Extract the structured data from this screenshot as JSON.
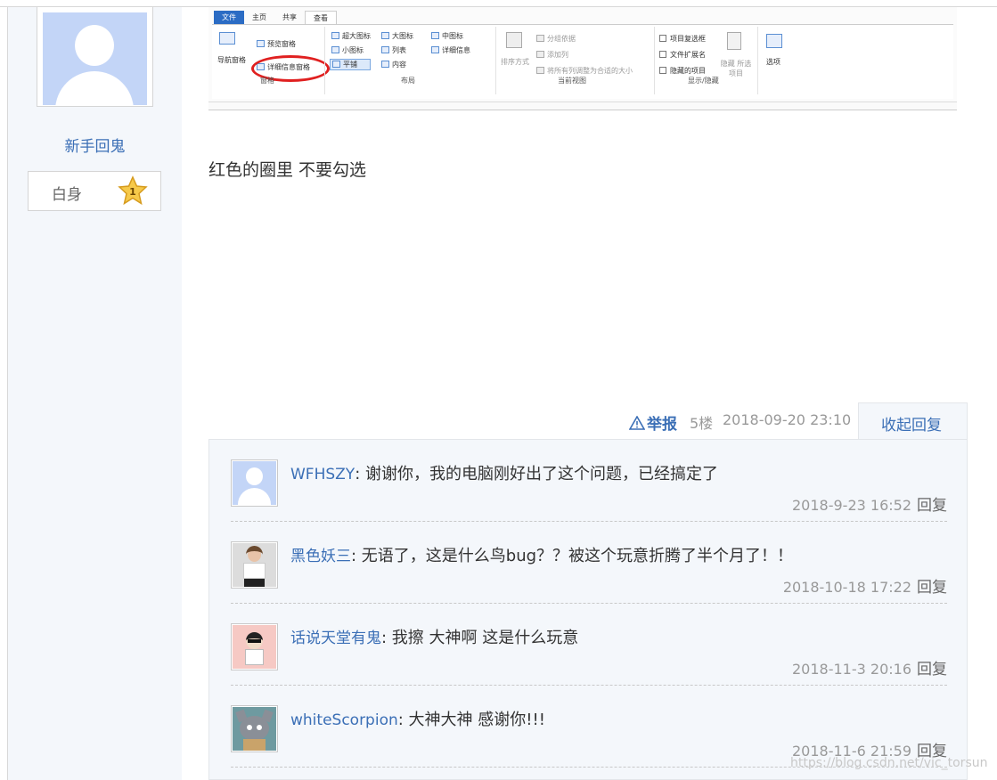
{
  "sidebar": {
    "username": "新手回鬼",
    "level_label": "白身",
    "level_number": "1"
  },
  "screenshot": {
    "tabs": [
      "文件",
      "主页",
      "共享",
      "查看"
    ],
    "pane_group": {
      "nav_pane": "导航窗格",
      "preview_pane": "预览窗格",
      "details_pane": "详细信息窗格",
      "label": "窗格"
    },
    "layout_group": {
      "items": [
        "超大图标",
        "大图标",
        "中图标",
        "小图标",
        "列表",
        "详细信息",
        "平铺",
        "内容"
      ],
      "label": "布局"
    },
    "current_view_group": {
      "sort": "排序方式",
      "group_by": "分组依据",
      "add_column": "添加列",
      "fit_columns": "将所有列调整为合适的大小",
      "label": "当前视图"
    },
    "show_hide_group": {
      "checkboxes": [
        "项目复选框",
        "文件扩展名",
        "隐藏的项目"
      ],
      "hide_selected": "隐藏 所选项目",
      "options": "选项",
      "label": "显示/隐藏"
    }
  },
  "post": {
    "text": "红色的圈里 不要勾选",
    "report": "举报",
    "floor": "5楼",
    "time": "2018-09-20 23:10",
    "collapse": "收起回复"
  },
  "replies": [
    {
      "user": "WFHSZY",
      "text": "谢谢你，我的电脑刚好出了这个问题，已经搞定了",
      "time": "2018-9-23 16:52",
      "reply": "回复"
    },
    {
      "user": "黑色妖三",
      "text": "无语了，这是什么鸟bug？？被这个玩意折腾了半个月了！！",
      "time": "2018-10-18 17:22",
      "reply": "回复"
    },
    {
      "user": "话说天堂有鬼",
      "text": "我擦 大神啊 这是什么玩意",
      "time": "2018-11-3 20:16",
      "reply": "回复"
    },
    {
      "user": "whiteScorpion",
      "text": "大神大神 感谢你!!!",
      "time": "2018-11-6 21:59",
      "reply": "回复"
    }
  ],
  "watermark": "https://blog.csdn.net/vic_torsun",
  "colors": {
    "link": "#3b6fb6",
    "sidebar_bg": "#f4f7fb",
    "avatar_bg": "#c3d5f7",
    "highlight_circle": "#e02020"
  }
}
